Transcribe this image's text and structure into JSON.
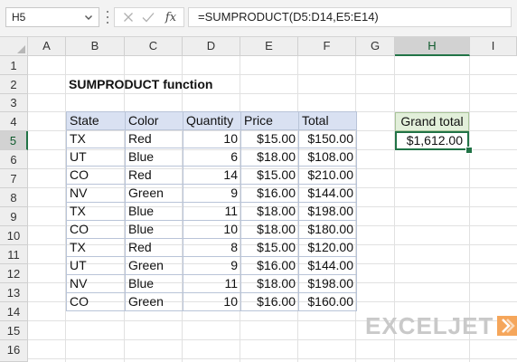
{
  "name_box": {
    "value": "H5"
  },
  "formula_bar": {
    "fx_label": "fx",
    "formula": "=SUMPRODUCT(D5:D14,E5:E14)"
  },
  "columns": [
    "A",
    "B",
    "C",
    "D",
    "E",
    "F",
    "G",
    "H",
    "I"
  ],
  "selected_column": "H",
  "rows": [
    "1",
    "2",
    "3",
    "4",
    "5",
    "6",
    "7",
    "8",
    "9",
    "10",
    "11",
    "12",
    "13",
    "14",
    "15",
    "16"
  ],
  "selected_row": "5",
  "sheet": {
    "title": "SUMPRODUCT function",
    "table": {
      "headers": [
        "State",
        "Color",
        "Quantity",
        "Price",
        "Total"
      ],
      "rows": [
        [
          "TX",
          "Red",
          "10",
          "$15.00",
          "$150.00"
        ],
        [
          "UT",
          "Blue",
          "6",
          "$18.00",
          "$108.00"
        ],
        [
          "CO",
          "Red",
          "14",
          "$15.00",
          "$210.00"
        ],
        [
          "NV",
          "Green",
          "9",
          "$16.00",
          "$144.00"
        ],
        [
          "TX",
          "Blue",
          "11",
          "$18.00",
          "$198.00"
        ],
        [
          "CO",
          "Blue",
          "10",
          "$18.00",
          "$180.00"
        ],
        [
          "TX",
          "Red",
          "8",
          "$15.00",
          "$120.00"
        ],
        [
          "UT",
          "Green",
          "9",
          "$16.00",
          "$144.00"
        ],
        [
          "NV",
          "Blue",
          "11",
          "$18.00",
          "$198.00"
        ],
        [
          "CO",
          "Green",
          "10",
          "$16.00",
          "$160.00"
        ]
      ]
    },
    "grand_total_label": "Grand total",
    "grand_total_value": "$1,612.00"
  },
  "logo": {
    "text": "EXCELJET"
  },
  "colors": {
    "accent": "#217346",
    "table_header_bg": "#d9e1f2",
    "grand_total_label_bg": "#e2efda",
    "logo_text": "#c9c9c9",
    "logo_mark": "#f5a65b"
  },
  "icons": [
    "chevron-down-icon",
    "cancel-icon",
    "confirm-icon",
    "fx-icon",
    "select-all-icon"
  ]
}
